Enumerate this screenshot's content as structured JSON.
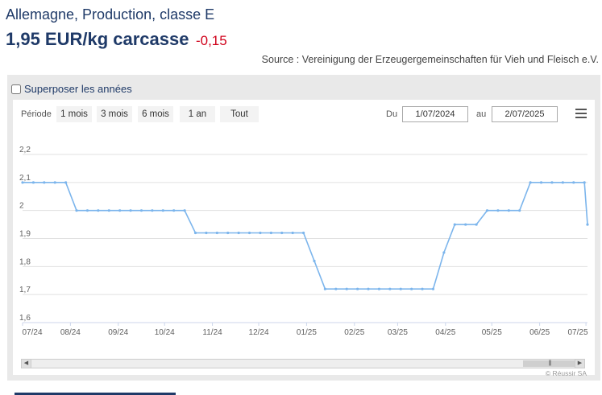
{
  "header": {
    "title": "Allemagne, Production, classe E",
    "price": "1,95 EUR/kg carcasse",
    "change": "-0,15",
    "source": "Source : Vereinigung der Erzeugergemeinschaften für Vieh und Fleisch e.V."
  },
  "controls": {
    "overlay_label": "Superposer les années",
    "period_label": "Période",
    "range_buttons": [
      "1 mois",
      "3 mois",
      "6 mois",
      "1 an",
      "Tout"
    ],
    "from_label": "Du",
    "from_value": "1/07/2024",
    "to_label": "au",
    "to_value": "2/07/2025",
    "menu_icon": "hamburger-menu-icon",
    "credits": "© Réussir SA"
  },
  "colors": {
    "title": "#1f3a68",
    "change": "#d0021b",
    "series": "#7cb5ec"
  },
  "chart_data": {
    "type": "line",
    "y_ticks": [
      "1,6",
      "1,7",
      "1,8",
      "1,9",
      "2",
      "2,1",
      "2,2"
    ],
    "ylim": [
      1.6,
      2.2
    ],
    "xlim": [
      "2024-07-01",
      "2025-07-02"
    ],
    "x_ticks": [
      {
        "label": "07/24",
        "date": "2024-07-01"
      },
      {
        "label": "08/24",
        "date": "2024-08-01"
      },
      {
        "label": "09/24",
        "date": "2024-09-01"
      },
      {
        "label": "10/24",
        "date": "2024-10-01"
      },
      {
        "label": "11/24",
        "date": "2024-11-01"
      },
      {
        "label": "12/24",
        "date": "2024-12-01"
      },
      {
        "label": "01/25",
        "date": "2025-01-01"
      },
      {
        "label": "02/25",
        "date": "2025-02-01"
      },
      {
        "label": "03/25",
        "date": "2025-03-01"
      },
      {
        "label": "04/25",
        "date": "2025-04-01"
      },
      {
        "label": "05/25",
        "date": "2025-05-01"
      },
      {
        "label": "06/25",
        "date": "2025-06-01"
      },
      {
        "label": "07/25",
        "date": "2025-07-01"
      }
    ],
    "grid": true,
    "legend": "none",
    "series": [
      {
        "points": [
          [
            "2024-07-01",
            2.1
          ],
          [
            "2024-07-08",
            2.1
          ],
          [
            "2024-07-15",
            2.1
          ],
          [
            "2024-07-22",
            2.1
          ],
          [
            "2024-07-29",
            2.1
          ],
          [
            "2024-08-05",
            2.0
          ],
          [
            "2024-08-12",
            2.0
          ],
          [
            "2024-08-19",
            2.0
          ],
          [
            "2024-08-26",
            2.0
          ],
          [
            "2024-09-02",
            2.0
          ],
          [
            "2024-09-09",
            2.0
          ],
          [
            "2024-09-16",
            2.0
          ],
          [
            "2024-09-23",
            2.0
          ],
          [
            "2024-09-30",
            2.0
          ],
          [
            "2024-10-07",
            2.0
          ],
          [
            "2024-10-14",
            2.0
          ],
          [
            "2024-10-21",
            1.92
          ],
          [
            "2024-10-28",
            1.92
          ],
          [
            "2024-11-04",
            1.92
          ],
          [
            "2024-11-11",
            1.92
          ],
          [
            "2024-11-18",
            1.92
          ],
          [
            "2024-11-25",
            1.92
          ],
          [
            "2024-12-02",
            1.92
          ],
          [
            "2024-12-09",
            1.92
          ],
          [
            "2024-12-16",
            1.92
          ],
          [
            "2024-12-23",
            1.92
          ],
          [
            "2024-12-30",
            1.92
          ],
          [
            "2025-01-06",
            1.82
          ],
          [
            "2025-01-13",
            1.72
          ],
          [
            "2025-01-20",
            1.72
          ],
          [
            "2025-01-27",
            1.72
          ],
          [
            "2025-02-03",
            1.72
          ],
          [
            "2025-02-10",
            1.72
          ],
          [
            "2025-02-17",
            1.72
          ],
          [
            "2025-02-24",
            1.72
          ],
          [
            "2025-03-03",
            1.72
          ],
          [
            "2025-03-10",
            1.72
          ],
          [
            "2025-03-17",
            1.72
          ],
          [
            "2025-03-24",
            1.72
          ],
          [
            "2025-03-31",
            1.85
          ],
          [
            "2025-04-07",
            1.95
          ],
          [
            "2025-04-14",
            1.95
          ],
          [
            "2025-04-21",
            1.95
          ],
          [
            "2025-04-28",
            2.0
          ],
          [
            "2025-05-05",
            2.0
          ],
          [
            "2025-05-12",
            2.0
          ],
          [
            "2025-05-19",
            2.0
          ],
          [
            "2025-05-26",
            2.1
          ],
          [
            "2025-06-02",
            2.1
          ],
          [
            "2025-06-09",
            2.1
          ],
          [
            "2025-06-16",
            2.1
          ],
          [
            "2025-06-23",
            2.1
          ],
          [
            "2025-06-30",
            2.1
          ],
          [
            "2025-07-02",
            1.95
          ]
        ]
      }
    ]
  }
}
